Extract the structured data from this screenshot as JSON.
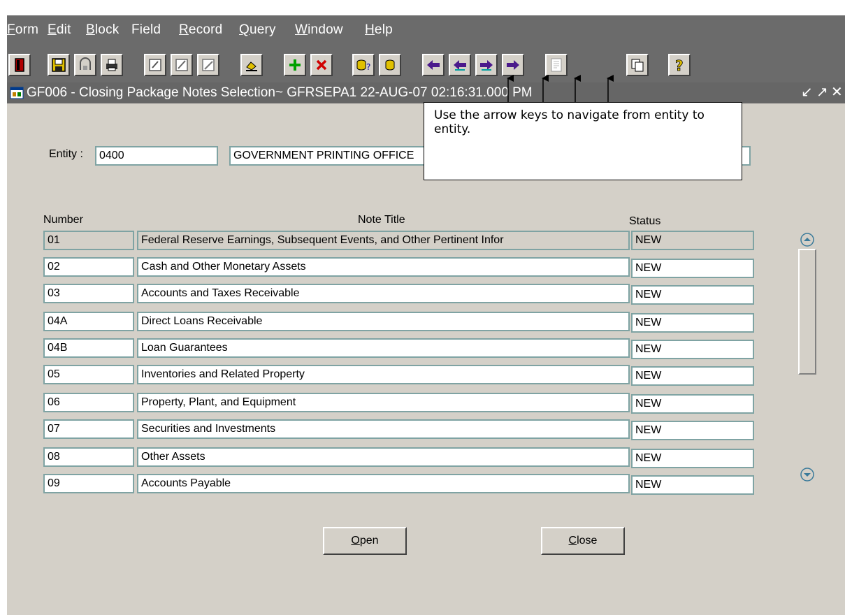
{
  "menubar": {
    "items": [
      {
        "first": "F",
        "rest": "orm"
      },
      {
        "first": "E",
        "rest": "dit"
      },
      {
        "first": "B",
        "rest": "lock"
      },
      {
        "first": "",
        "rest": "Field"
      },
      {
        "first": "R",
        "rest": "ecord"
      },
      {
        "first": "Q",
        "rest": "uery"
      },
      {
        "first": "W",
        "rest": "indow"
      },
      {
        "first": "H",
        "rest": "elp"
      }
    ]
  },
  "toolbar": {
    "buttons": [
      "exit",
      "save",
      "print-preview",
      "print",
      "edit",
      "edit-copy",
      "edit-clear",
      "clear-field",
      "insert-record",
      "delete-record",
      "enter-query",
      "execute-query",
      "previous-block",
      "previous-record",
      "next-record",
      "next-block",
      "list",
      "copy",
      "help"
    ]
  },
  "window": {
    "title": "GF006 - Closing Package Notes Selection~  GFRSEPA1  22-AUG-07 02:16:31.000 PM"
  },
  "callout": {
    "text": "Use the arrow keys to navigate from entity to entity."
  },
  "entity": {
    "label": "Entity :",
    "code": "0400",
    "name": "GOVERNMENT PRINTING OFFICE"
  },
  "table": {
    "headers": {
      "number": "Number",
      "title": "Note Title",
      "status": "Status"
    },
    "rows": [
      {
        "number": "01",
        "title": "Federal Reserve Earnings, Subsequent Events, and Other Pertinent Infor",
        "status": "NEW"
      },
      {
        "number": "02",
        "title": "Cash and Other Monetary Assets",
        "status": "NEW"
      },
      {
        "number": "03",
        "title": "Accounts and Taxes Receivable",
        "status": "NEW"
      },
      {
        "number": "04A",
        "title": "Direct Loans Receivable",
        "status": "NEW"
      },
      {
        "number": "04B",
        "title": "Loan Guarantees",
        "status": "NEW"
      },
      {
        "number": "05",
        "title": "Inventories and Related Property",
        "status": "NEW"
      },
      {
        "number": "06",
        "title": "Property, Plant, and Equipment",
        "status": "NEW"
      },
      {
        "number": "07",
        "title": "Securities and Investments",
        "status": "NEW"
      },
      {
        "number": "08",
        "title": "Other Assets",
        "status": "NEW"
      },
      {
        "number": "09",
        "title": "Accounts Payable",
        "status": "NEW"
      }
    ]
  },
  "buttons": {
    "open": {
      "first": "O",
      "rest": "pen"
    },
    "close": {
      "first": "C",
      "rest": "lose"
    }
  },
  "colors": {
    "chrome": "#6b6b6b",
    "dialog": "#d4d0c8",
    "field_border": "#7fa3a3",
    "nav_arrow": "#4b1a8c"
  }
}
